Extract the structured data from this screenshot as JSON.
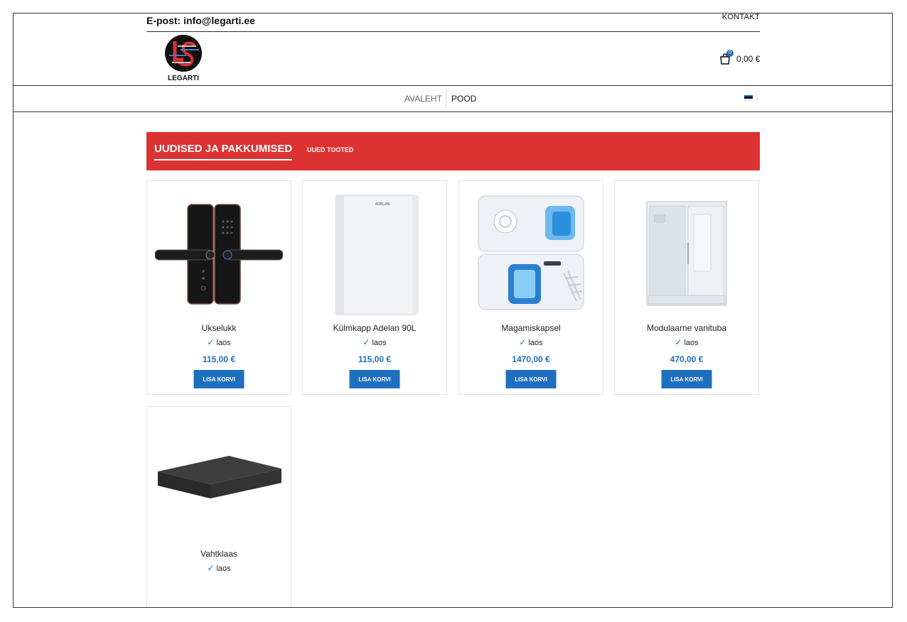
{
  "header": {
    "email": "E-post: info@legarti.ee",
    "kontakt": "KONTAKT",
    "logo_text": "LEGARTI",
    "cart_count": "0",
    "cart_total": "0,00 €"
  },
  "nav": {
    "items": [
      "AVALEHT",
      "POOD"
    ]
  },
  "banner": {
    "title": "UUDISED JA PAKKUMISED",
    "tab": "UUED TOOTED"
  },
  "products": [
    {
      "name": "Ukselukk",
      "stock": "laos",
      "price": "115,00 €",
      "button": "LISA KORVI"
    },
    {
      "name": "Külmkapp Adelan 90L",
      "stock": "laos",
      "price": "115,00 €",
      "button": "LISA KORVI"
    },
    {
      "name": "Magamiskapsel",
      "stock": "laos",
      "price": "1470,00 €",
      "button": "LISA KORVI"
    },
    {
      "name": "Modulaarne vanituba",
      "stock": "laos",
      "price": "470,00 €",
      "button": "LISA KORVI"
    },
    {
      "name": "Vahtklaas",
      "stock": "laos"
    }
  ],
  "product_icons": [
    "door-lock-icon",
    "fridge-icon",
    "sleep-capsule-icon",
    "shower-room-icon",
    "foam-board-icon"
  ],
  "fridge_brand": "ADELAN",
  "colors": {
    "accent_red": "#dc3232",
    "accent_blue": "#1f6fbf",
    "flag": [
      "#0072ce",
      "#000000",
      "#ffffff"
    ]
  }
}
